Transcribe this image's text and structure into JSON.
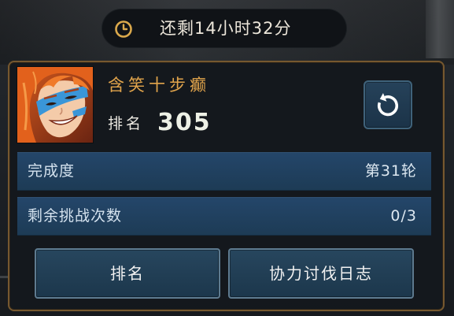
{
  "timer": {
    "icon": "clock-icon",
    "text": "还剩14小时32分"
  },
  "player": {
    "name": "含笑十步癫",
    "rank_label": "排名",
    "rank_value": "305"
  },
  "refresh_button": {
    "icon": "refresh-icon"
  },
  "stats": [
    {
      "label": "完成度",
      "value": "第31轮"
    },
    {
      "label": "剩余挑战次数",
      "value": "0/3"
    }
  ],
  "buttons": {
    "rank": "排名",
    "log": "协力讨伐日志"
  },
  "colors": {
    "accent_gold": "#e2a54c",
    "panel_border": "#76582f",
    "row_bg_top": "#24466a",
    "row_bg": "#1d3b55",
    "button_bg": "#1c374c",
    "button_border": "#5e7b90"
  }
}
